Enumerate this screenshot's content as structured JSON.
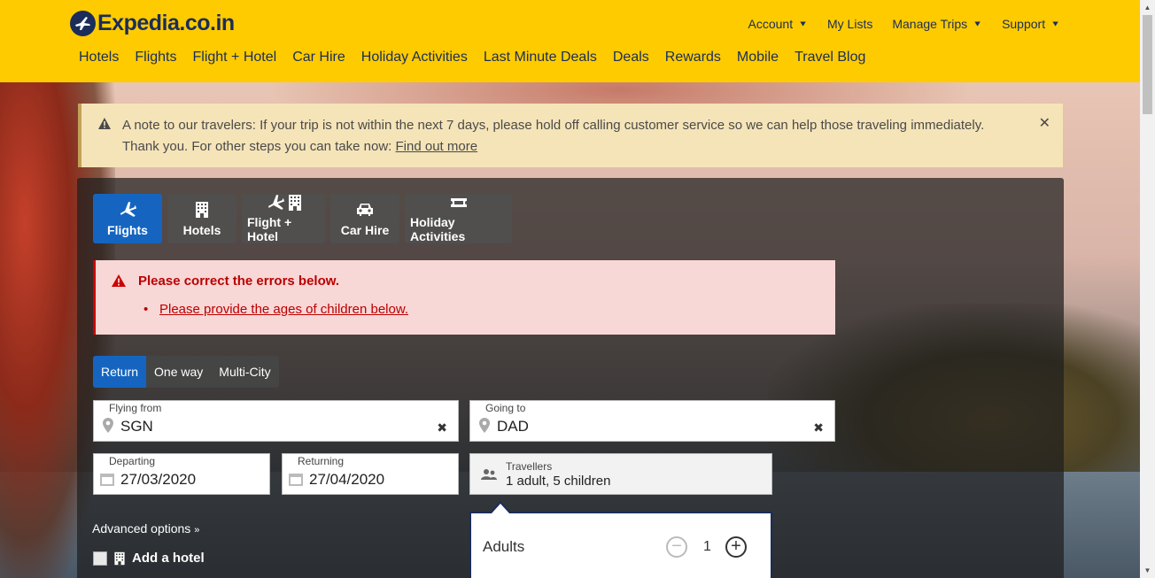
{
  "header": {
    "logo": "Expedia.co.in",
    "util_nav": [
      {
        "label": "Account",
        "dropdown": true
      },
      {
        "label": "My Lists",
        "dropdown": false
      },
      {
        "label": "Manage Trips",
        "dropdown": true
      },
      {
        "label": "Support",
        "dropdown": true
      }
    ],
    "main_nav": [
      "Hotels",
      "Flights",
      "Flight + Hotel",
      "Car Hire",
      "Holiday Activities",
      "Last Minute Deals",
      "Deals",
      "Rewards",
      "Mobile",
      "Travel Blog"
    ]
  },
  "banner": {
    "text": "A note to our travelers: If your trip is not within the next 7 days, please hold off calling customer service so we can help those traveling immediately. Thank you. For other steps you can take now:",
    "link": "Find out more"
  },
  "tabs": [
    {
      "label": "Flights",
      "icon": "plane-icon",
      "active": true
    },
    {
      "label": "Hotels",
      "icon": "building-icon",
      "active": false
    },
    {
      "label": "Flight + Hotel",
      "icon": "plane-building-icon",
      "active": false
    },
    {
      "label": "Car Hire",
      "icon": "car-icon",
      "active": false
    },
    {
      "label": "Holiday Activities",
      "icon": "ticket-icon",
      "active": false
    }
  ],
  "error": {
    "title": "Please correct the errors below.",
    "item": "Please provide the ages of children below."
  },
  "trip_type": {
    "options": [
      "Return",
      "One way",
      "Multi-City"
    ],
    "selected": "Return"
  },
  "form": {
    "from_label": "Flying from",
    "from_value": "SGN",
    "to_label": "Going to",
    "to_value": "DAD",
    "depart_label": "Departing",
    "depart_value": "27/03/2020",
    "return_label": "Returning",
    "return_value": "27/04/2020",
    "travellers_label": "Travellers",
    "travellers_value": "1 adult, 5 children"
  },
  "travellers_popup": {
    "adults_label": "Adults",
    "adults_value": "1"
  },
  "advanced_options": "Advanced options",
  "add_hotel": "Add a hotel",
  "colors": {
    "header_bg": "#fecb00",
    "brand_navy": "#1b2d5b",
    "active_blue": "#1565c0",
    "error_red": "#bb0000"
  }
}
